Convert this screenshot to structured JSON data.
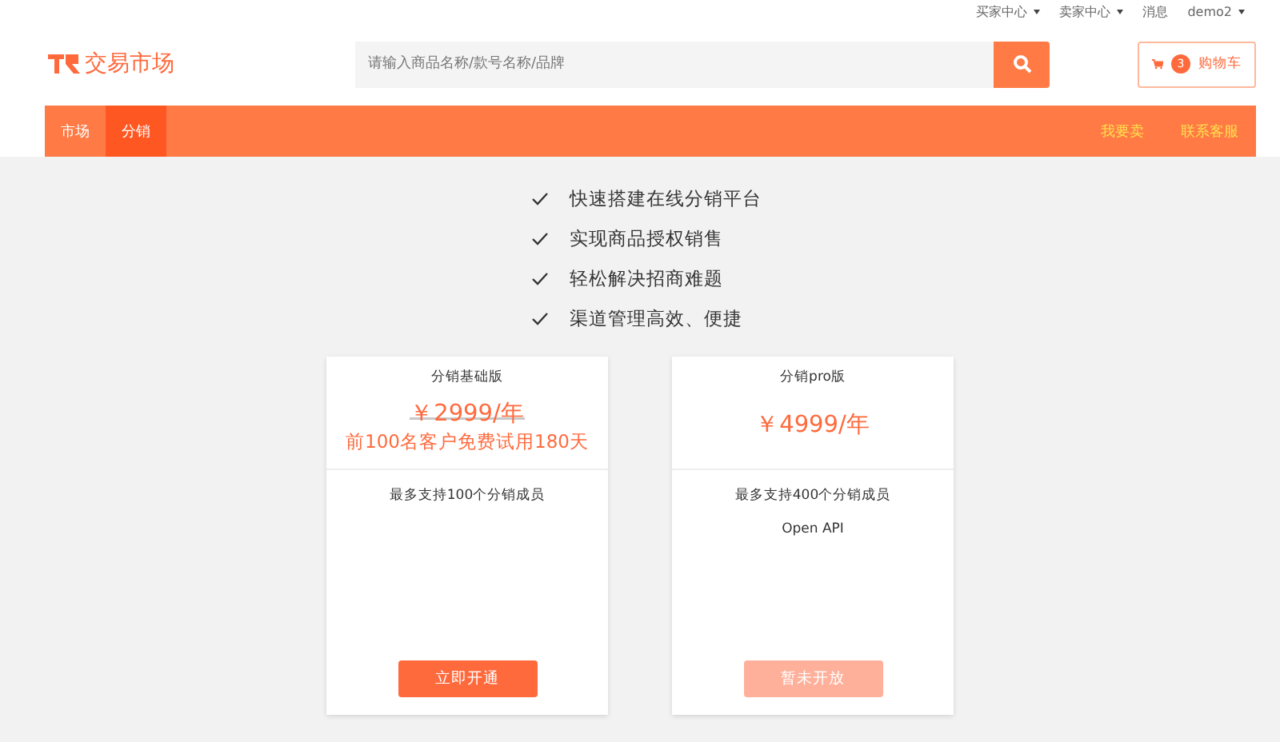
{
  "top_links": [
    {
      "label": "买家中心",
      "dropdown": true
    },
    {
      "label": "卖家中心",
      "dropdown": true
    },
    {
      "label": "消息",
      "dropdown": false
    },
    {
      "label": "demo2",
      "dropdown": true
    }
  ],
  "logo": {
    "text": "交易市场"
  },
  "search": {
    "placeholder": "请输入商品名称/款号名称/品牌"
  },
  "cart": {
    "count": "3",
    "label": "购物车"
  },
  "nav": {
    "tabs": [
      {
        "label": "市场",
        "selected": false
      },
      {
        "label": "分销",
        "selected": true
      }
    ],
    "links": [
      "我要卖",
      "联系客服"
    ]
  },
  "benefits": [
    "快速搭建在线分销平台",
    "实现商品授权销售",
    "轻松解决招商难题",
    "渠道管理高效、便捷"
  ],
  "plans": [
    {
      "name": "分销基础版",
      "price": "￥2999/年",
      "struck": true,
      "promo": "前100名客户免费试用180天",
      "features": [
        "最多支持100个分销成员"
      ],
      "button": "立即开通",
      "disabled": false
    },
    {
      "name": "分销pro版",
      "price": "￥4999/年",
      "struck": false,
      "features": [
        "最多支持400个分销成员",
        "Open API"
      ],
      "button": "暂未开放",
      "disabled": true
    }
  ]
}
